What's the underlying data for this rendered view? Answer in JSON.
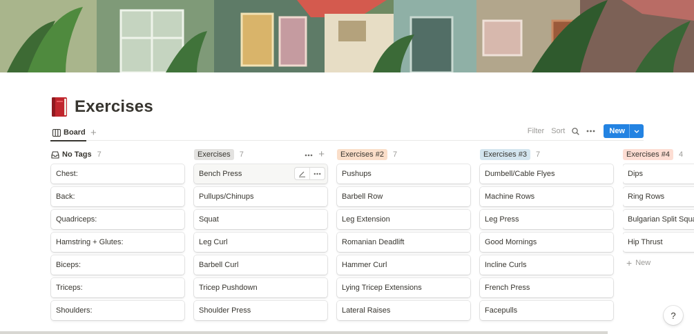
{
  "page": {
    "title": "Exercises",
    "icon": "red-book-icon"
  },
  "views": {
    "active_tab": "Board",
    "add_icon": "plus-icon"
  },
  "actions": {
    "filter": "Filter",
    "sort": "Sort",
    "search_icon": "search-icon",
    "more_icon": "ellipsis-icon",
    "new_label": "New",
    "new_caret_icon": "chevron-down-icon"
  },
  "colors": {
    "accent": "#2383e2",
    "tag_default": "#e3e2e0",
    "tag_orange": "#fadec9",
    "tag_blue": "#d3e5ef",
    "tag_peach": "#fdddd3"
  },
  "board": {
    "columns": [
      {
        "name": "No Tags",
        "count": "7",
        "cards": [
          "Chest:",
          "Back:",
          "Quadriceps:",
          "Hamstring + Glutes:",
          "Biceps:",
          "Triceps:",
          "Shoulders:"
        ]
      },
      {
        "name": "Exercises",
        "count": "7",
        "cards": [
          "Bench Press",
          "Pullups/Chinups",
          "Squat",
          "Leg Curl",
          "Barbell Curl",
          "Tricep Pushdown",
          "Shoulder Press"
        ]
      },
      {
        "name": "Exercises #2",
        "count": "7",
        "cards": [
          "Pushups",
          "Barbell Row",
          "Leg Extension",
          "Romanian Deadlift",
          "Hammer Curl",
          "Lying Tricep Extensions",
          "Lateral Raises"
        ]
      },
      {
        "name": "Exercises #3",
        "count": "7",
        "cards": [
          "Dumbell/Cable Flyes",
          "Machine Rows",
          "Leg Press",
          "Good Mornings",
          "Incline Curls",
          "French Press",
          "Facepulls"
        ]
      },
      {
        "name": "Exercises #4",
        "count": "4",
        "cards": [
          "Dips",
          "Ring Rows",
          "Bulgarian Split Squat",
          "Hip Thrust"
        ],
        "new_label": "New"
      }
    ]
  },
  "help": "?"
}
